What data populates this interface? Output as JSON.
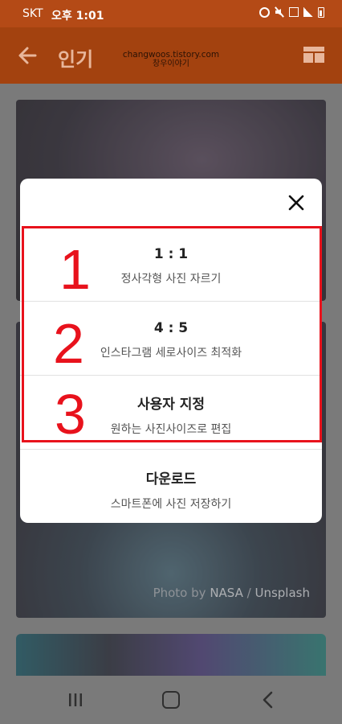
{
  "status_bar": {
    "carrier": "SKT",
    "time": "오후 1:01",
    "icons": [
      "alarm-icon",
      "mute-icon",
      "lte-icon",
      "signal-icon",
      "battery-icon"
    ]
  },
  "app_bar": {
    "title": "인기",
    "watermark_line1": "changwoos.tistory.com",
    "watermark_line2": "창우이야기",
    "background_color": "#a3420f"
  },
  "photo_credit": {
    "prefix": "Photo by",
    "author": "NASA",
    "separator": "/",
    "source": "Unsplash"
  },
  "dialog": {
    "options": [
      {
        "main": "1 : 1",
        "sub": "정사각형 사진 자르기"
      },
      {
        "main": "4 : 5",
        "sub": "인스타그램 세로사이즈 최적화"
      },
      {
        "main": "사용자 지정",
        "sub": "원하는 사진사이즈로 편집"
      },
      {
        "main": "다운로드",
        "sub": "스마트폰에 사진 저장하기"
      }
    ]
  },
  "annotation": {
    "numbers": [
      "1",
      "2",
      "3"
    ],
    "color": "#e8121c"
  }
}
